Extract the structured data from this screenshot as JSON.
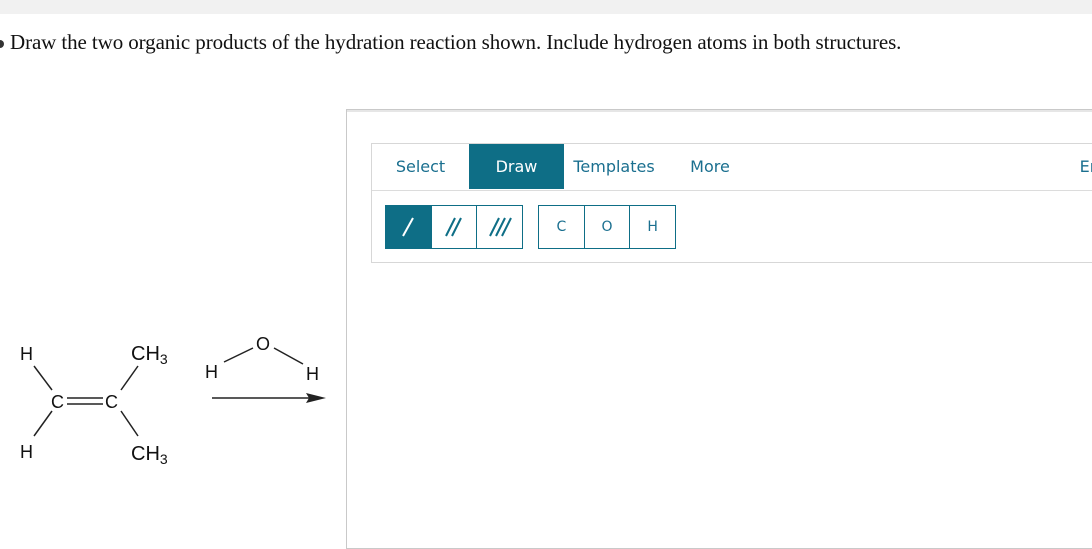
{
  "question": "Draw the two organic products of the hydration reaction shown. Include hydrogen atoms in both structures.",
  "toolbar": {
    "tabs": [
      {
        "label": "Select",
        "active": false
      },
      {
        "label": "Draw",
        "active": true
      },
      {
        "label": "Templates",
        "active": false
      },
      {
        "label": "More",
        "active": false
      },
      {
        "label": "Er",
        "active": false
      }
    ],
    "bond_buttons": [
      {
        "icon": "single-bond-icon",
        "active": true
      },
      {
        "icon": "double-bond-icon",
        "active": false
      },
      {
        "icon": "triple-bond-icon",
        "active": false
      }
    ],
    "atom_buttons": [
      "C",
      "O",
      "H"
    ]
  },
  "reaction": {
    "reactant": {
      "h_top": "H",
      "h_bottom": "H",
      "c_left": "C",
      "c_right": "C",
      "ch3_top": "CH",
      "ch3_top_sub": "3",
      "ch3_bottom": "CH",
      "ch3_bottom_sub": "3"
    },
    "reagent": {
      "o": "O",
      "h_left": "H",
      "h_right": "H"
    }
  },
  "colors": {
    "accent": "#0e6e86",
    "tab_text": "#1a6f8f",
    "top_strip": "#f1f1f1"
  }
}
